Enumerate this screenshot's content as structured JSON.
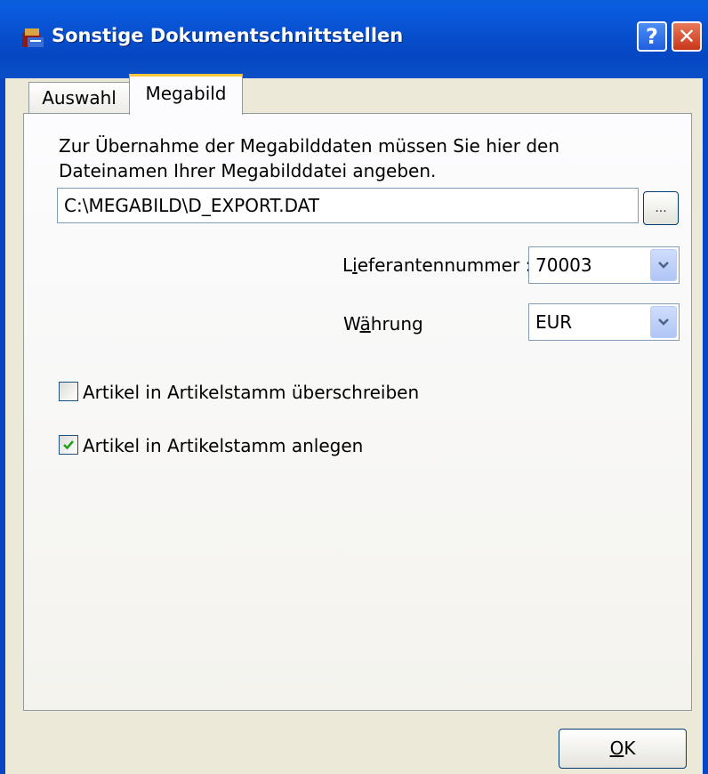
{
  "window": {
    "title": "Sonstige Dokumentschnittstellen",
    "help_label": "?",
    "close_label": "✕"
  },
  "tabs": [
    {
      "label": "Auswahl",
      "selected": false
    },
    {
      "label": "Megabild",
      "selected": true
    }
  ],
  "megabild": {
    "description_line1": "Zur Übernahme der Megabilddaten müssen Sie hier den",
    "description_line2": "Dateinamen Ihrer Megabilddatei angeben.",
    "file_path": "C:\\MEGABILD\\D_EXPORT.DAT",
    "browse_label": "...",
    "lieferant_label_pre": "L",
    "lieferant_label_mnemonic": "i",
    "lieferant_label_post": "eferantennummer :",
    "lieferant_value": "70003",
    "waehrung_label_pre": "W",
    "waehrung_label_mnemonic": "ä",
    "waehrung_label_post": "hrung",
    "waehrung_value": "EUR",
    "checkbox_overwrite_label": "Artikel in Artikelstamm überschreiben",
    "checkbox_overwrite_checked": false,
    "checkbox_create_label": "Artikel in Artikelstamm anlegen",
    "checkbox_create_checked": true
  },
  "footer": {
    "ok_mnemonic": "O",
    "ok_rest": "K"
  },
  "colors": {
    "titlebar": "#0846c3",
    "tab_highlight": "#ffc83c",
    "check_green": "#21a121"
  }
}
